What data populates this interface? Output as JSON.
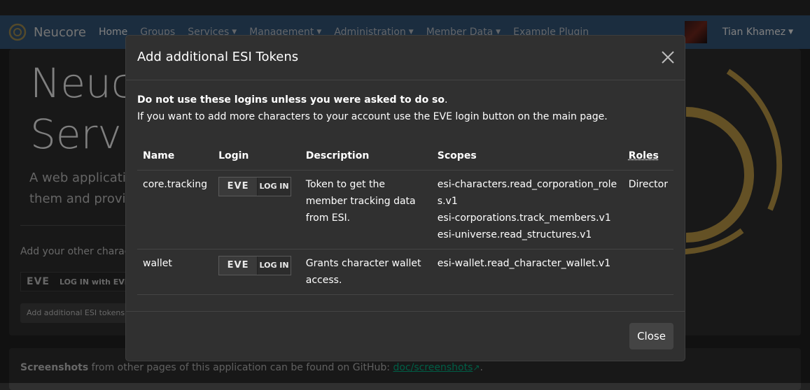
{
  "app": {
    "brand": "Neucore"
  },
  "nav": {
    "items": [
      {
        "label": "Home",
        "muted": false,
        "dropdown": false
      },
      {
        "label": "Groups",
        "muted": true,
        "dropdown": false
      },
      {
        "label": "Services",
        "muted": true,
        "dropdown": true
      },
      {
        "label": "Management",
        "muted": true,
        "dropdown": true
      },
      {
        "label": "Administration",
        "muted": true,
        "dropdown": true
      },
      {
        "label": "Member Data",
        "muted": true,
        "dropdown": true
      },
      {
        "label": "Example Plugin",
        "muted": true,
        "dropdown": false
      }
    ],
    "user": "Tian Khamez"
  },
  "page": {
    "title_line1": "Neucore",
    "title_line2": "Services",
    "lead_line1": "A web application to",
    "lead_line2": "them and provide a",
    "add_chars": "Add your other characters",
    "eve_main_btn": "LOG IN with EVE",
    "add_tokens_btn": "Add additional ESI tokens"
  },
  "footer": {
    "bold": "Screenshots",
    "text": " from other pages of this application can be found on GitHub: ",
    "link": "doc/screenshots",
    "end": "."
  },
  "modal": {
    "title": "Add additional ESI Tokens",
    "warning_bold": "Do not use these logins unless you were asked to do so",
    "warning_end": ".",
    "info": "If you want to add more characters to your account use the EVE login button on the main page.",
    "columns": [
      "Name",
      "Login",
      "Description",
      "Scopes",
      "Roles"
    ],
    "eve_logo": "EVE",
    "login_text": "LOG IN",
    "rows": [
      {
        "name": "core.tracking",
        "description": "Token to get the member tracking data from ESI.",
        "scopes": [
          "esi-characters.read_corporation_roles.v1",
          "esi-corporations.track_members.v1",
          "esi-universe.read_structures.v1"
        ],
        "roles": "Director"
      },
      {
        "name": "wallet",
        "description": "Grants character wallet access.",
        "scopes": [
          "esi-wallet.read_character_wallet.v1"
        ],
        "roles": ""
      }
    ],
    "close_btn": "Close"
  },
  "colors": {
    "navbar": "#375a7f",
    "accent_gold": "#c8a24a",
    "link": "#00bc8c"
  }
}
